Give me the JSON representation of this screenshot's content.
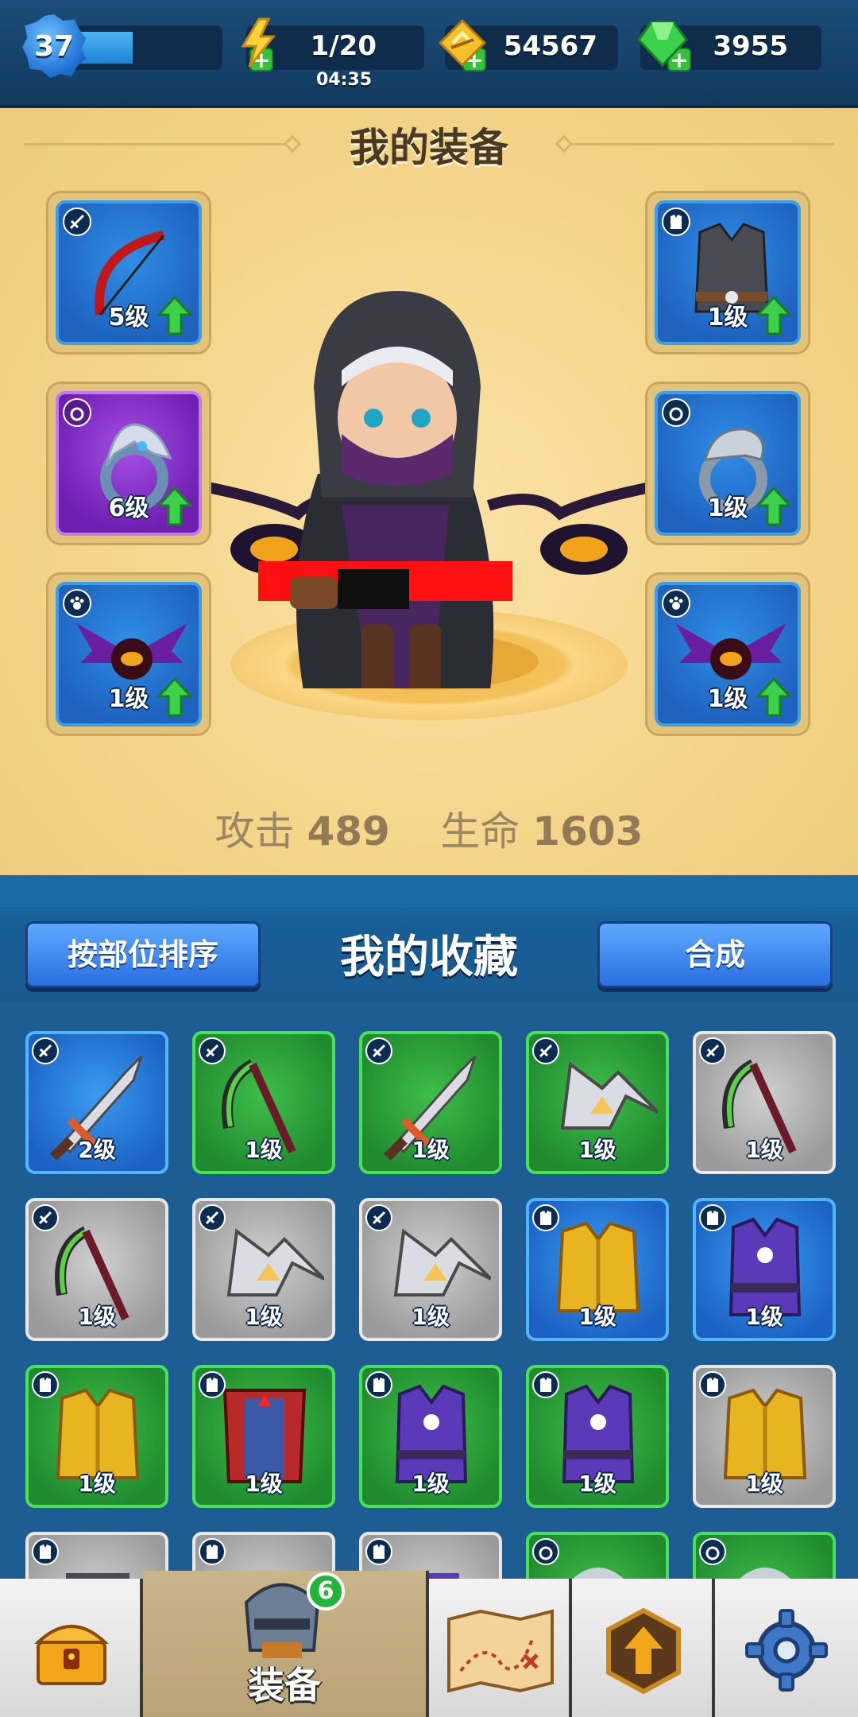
{
  "topbar": {
    "player_level": "37",
    "xp_progress": 0.46,
    "energy": "1/20",
    "energy_timer": "04:35",
    "gold": "54567",
    "gems": "3955",
    "plus_symbol": "+"
  },
  "equipment": {
    "title": "我的装备",
    "slots": [
      {
        "name": "bow",
        "level": "5级",
        "rarity": "blue",
        "upgradable": true
      },
      {
        "name": "armor",
        "level": "1级",
        "rarity": "blue",
        "upgradable": true
      },
      {
        "name": "dragon-ring",
        "level": "6级",
        "rarity": "purple",
        "upgradable": true
      },
      {
        "name": "serpent-ring",
        "level": "1级",
        "rarity": "blue",
        "upgradable": true
      },
      {
        "name": "bat-pet",
        "level": "1级",
        "rarity": "blue",
        "upgradable": true
      },
      {
        "name": "bat-pet",
        "level": "1级",
        "rarity": "blue",
        "upgradable": true
      }
    ],
    "stats": {
      "attack_label": "攻击",
      "attack_value": "489",
      "hp_label": "生命",
      "hp_value": "1603"
    }
  },
  "collection": {
    "sort_button": "按部位排序",
    "title": "我的收藏",
    "merge_button": "合成",
    "items": [
      {
        "name": "sword",
        "level": "2级",
        "rarity": "blue"
      },
      {
        "name": "scythe",
        "level": "1级",
        "rarity": "green"
      },
      {
        "name": "sword",
        "level": "1级",
        "rarity": "green"
      },
      {
        "name": "shuriken",
        "level": "1级",
        "rarity": "green"
      },
      {
        "name": "scythe",
        "level": "1级",
        "rarity": "gray"
      },
      {
        "name": "scythe",
        "level": "1级",
        "rarity": "gray"
      },
      {
        "name": "shuriken",
        "level": "1级",
        "rarity": "gray"
      },
      {
        "name": "shuriken",
        "level": "1级",
        "rarity": "gray"
      },
      {
        "name": "gold-armor",
        "level": "1级",
        "rarity": "blue"
      },
      {
        "name": "purple-robe",
        "level": "1级",
        "rarity": "blue"
      },
      {
        "name": "gold-armor",
        "level": "1级",
        "rarity": "green"
      },
      {
        "name": "red-cloak",
        "level": "1级",
        "rarity": "green"
      },
      {
        "name": "purple-robe",
        "level": "1级",
        "rarity": "green"
      },
      {
        "name": "purple-robe",
        "level": "1级",
        "rarity": "green"
      },
      {
        "name": "gold-armor",
        "level": "1级",
        "rarity": "gray"
      },
      {
        "name": "armor",
        "level": "",
        "rarity": "gray"
      },
      {
        "name": "cloak",
        "level": "",
        "rarity": "gray"
      },
      {
        "name": "robe",
        "level": "",
        "rarity": "gray"
      },
      {
        "name": "ring",
        "level": "",
        "rarity": "green"
      },
      {
        "name": "ring",
        "level": "",
        "rarity": "green"
      }
    ]
  },
  "nav": {
    "equipment_label": "装备",
    "equipment_badge": "6"
  },
  "colors": {
    "accent_blue": "#2a6fe0",
    "panel_bg": "#f4d58a",
    "rarity_blue": "#1c62c4",
    "rarity_green": "#1f8a2e",
    "rarity_gray": "#9a9a9a",
    "rarity_purple": "#6e1fb0"
  }
}
